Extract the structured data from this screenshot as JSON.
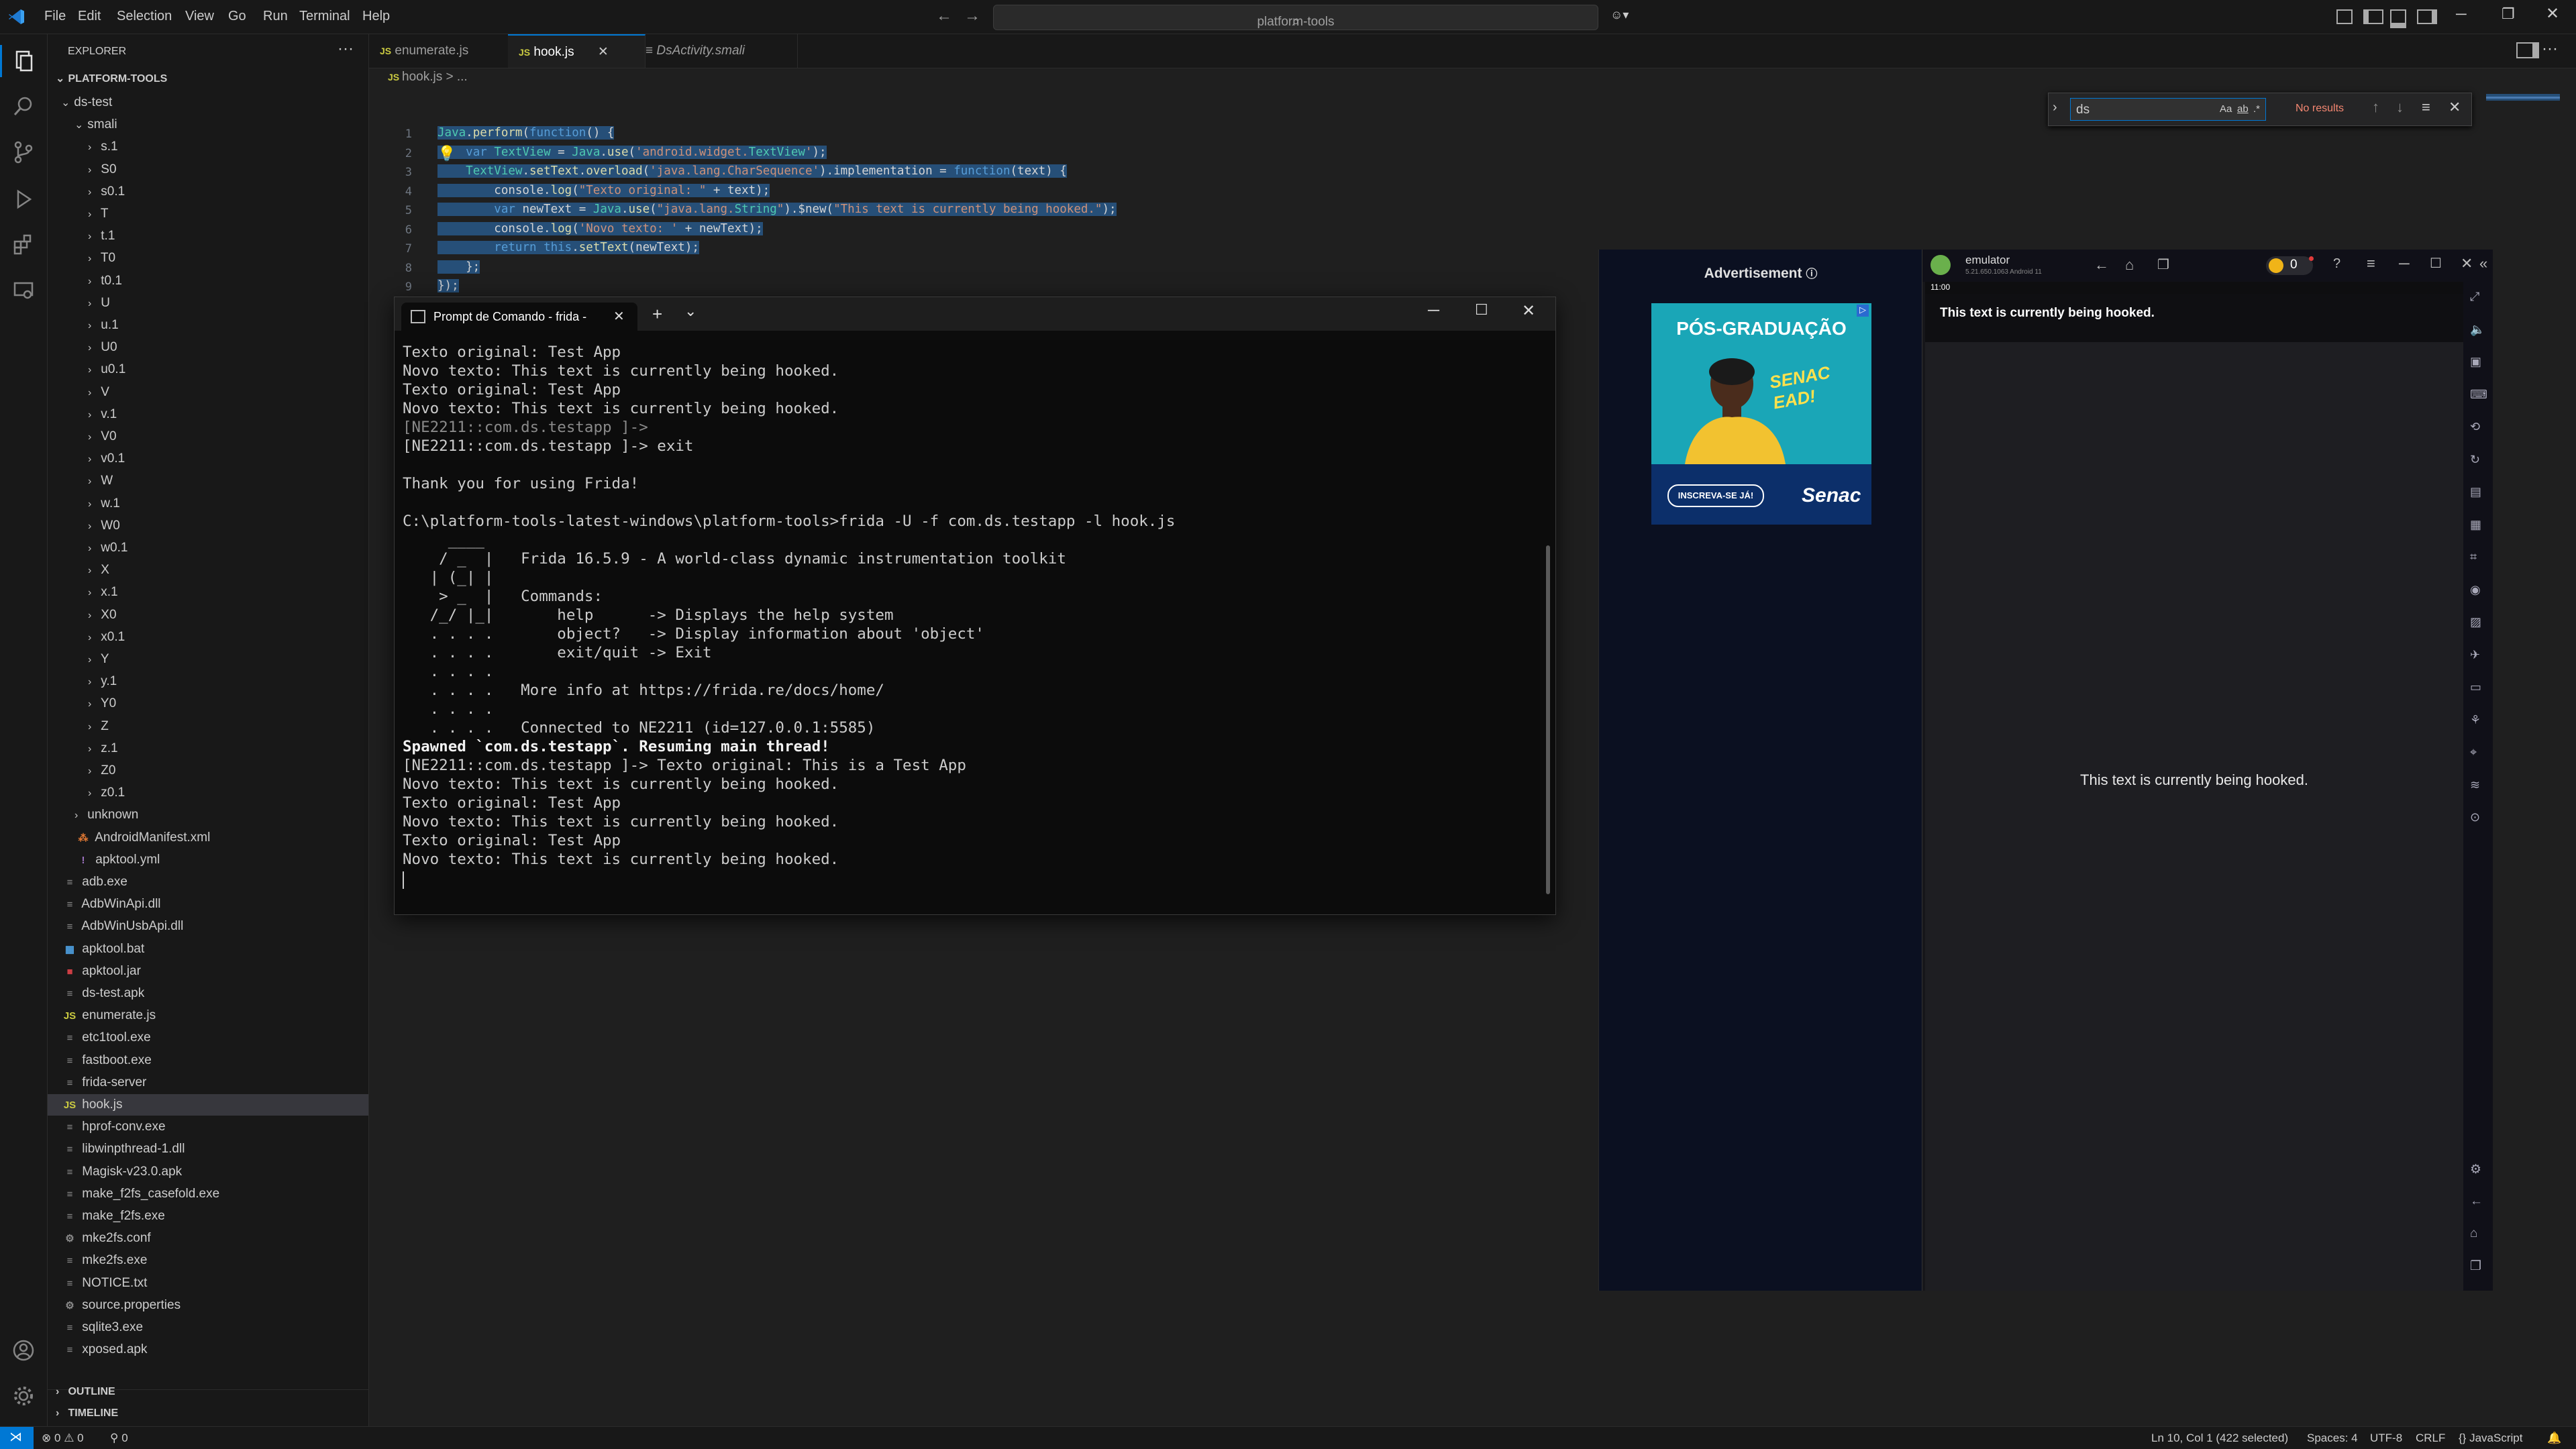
{
  "menu": [
    "File",
    "Edit",
    "Selection",
    "View",
    "Go",
    "Run",
    "Terminal",
    "Help"
  ],
  "command_center": "platform-tools",
  "sidebar": {
    "title": "EXPLORER",
    "root": "PLATFORM-TOOLS",
    "outline": "OUTLINE",
    "timeline": "TIMELINE",
    "tree": [
      {
        "label": "ds-test",
        "depth": 0,
        "chev": "v",
        "icon": ""
      },
      {
        "label": "smali",
        "depth": 1,
        "chev": "v",
        "icon": ""
      },
      {
        "label": "s.1",
        "depth": 2,
        "chev": ">",
        "icon": ""
      },
      {
        "label": "S0",
        "depth": 2,
        "chev": ">",
        "icon": ""
      },
      {
        "label": "s0.1",
        "depth": 2,
        "chev": ">",
        "icon": ""
      },
      {
        "label": "T",
        "depth": 2,
        "chev": ">",
        "icon": ""
      },
      {
        "label": "t.1",
        "depth": 2,
        "chev": ">",
        "icon": ""
      },
      {
        "label": "T0",
        "depth": 2,
        "chev": ">",
        "icon": ""
      },
      {
        "label": "t0.1",
        "depth": 2,
        "chev": ">",
        "icon": ""
      },
      {
        "label": "U",
        "depth": 2,
        "chev": ">",
        "icon": ""
      },
      {
        "label": "u.1",
        "depth": 2,
        "chev": ">",
        "icon": ""
      },
      {
        "label": "U0",
        "depth": 2,
        "chev": ">",
        "icon": ""
      },
      {
        "label": "u0.1",
        "depth": 2,
        "chev": ">",
        "icon": ""
      },
      {
        "label": "V",
        "depth": 2,
        "chev": ">",
        "icon": ""
      },
      {
        "label": "v.1",
        "depth": 2,
        "chev": ">",
        "icon": ""
      },
      {
        "label": "V0",
        "depth": 2,
        "chev": ">",
        "icon": ""
      },
      {
        "label": "v0.1",
        "depth": 2,
        "chev": ">",
        "icon": ""
      },
      {
        "label": "W",
        "depth": 2,
        "chev": ">",
        "icon": ""
      },
      {
        "label": "w.1",
        "depth": 2,
        "chev": ">",
        "icon": ""
      },
      {
        "label": "W0",
        "depth": 2,
        "chev": ">",
        "icon": ""
      },
      {
        "label": "w0.1",
        "depth": 2,
        "chev": ">",
        "icon": ""
      },
      {
        "label": "X",
        "depth": 2,
        "chev": ">",
        "icon": ""
      },
      {
        "label": "x.1",
        "depth": 2,
        "chev": ">",
        "icon": ""
      },
      {
        "label": "X0",
        "depth": 2,
        "chev": ">",
        "icon": ""
      },
      {
        "label": "x0.1",
        "depth": 2,
        "chev": ">",
        "icon": ""
      },
      {
        "label": "Y",
        "depth": 2,
        "chev": ">",
        "icon": ""
      },
      {
        "label": "y.1",
        "depth": 2,
        "chev": ">",
        "icon": ""
      },
      {
        "label": "Y0",
        "depth": 2,
        "chev": ">",
        "icon": ""
      },
      {
        "label": "Z",
        "depth": 2,
        "chev": ">",
        "icon": ""
      },
      {
        "label": "z.1",
        "depth": 2,
        "chev": ">",
        "icon": ""
      },
      {
        "label": "Z0",
        "depth": 2,
        "chev": ">",
        "icon": ""
      },
      {
        "label": "z0.1",
        "depth": 2,
        "chev": ">",
        "icon": ""
      },
      {
        "label": "unknown",
        "depth": 1,
        "chev": ">",
        "icon": ""
      },
      {
        "label": "AndroidManifest.xml",
        "depth": 1,
        "chev": "",
        "icon": "xml"
      },
      {
        "label": "apktool.yml",
        "depth": 1,
        "chev": "",
        "icon": "yml"
      },
      {
        "label": "adb.exe",
        "depth": 0,
        "chev": "",
        "icon": "file"
      },
      {
        "label": "AdbWinApi.dll",
        "depth": 0,
        "chev": "",
        "icon": "file"
      },
      {
        "label": "AdbWinUsbApi.dll",
        "depth": 0,
        "chev": "",
        "icon": "file"
      },
      {
        "label": "apktool.bat",
        "depth": 0,
        "chev": "",
        "icon": "bat"
      },
      {
        "label": "apktool.jar",
        "depth": 0,
        "chev": "",
        "icon": "jar"
      },
      {
        "label": "ds-test.apk",
        "depth": 0,
        "chev": "",
        "icon": "file"
      },
      {
        "label": "enumerate.js",
        "depth": 0,
        "chev": "",
        "icon": "js"
      },
      {
        "label": "etc1tool.exe",
        "depth": 0,
        "chev": "",
        "icon": "file"
      },
      {
        "label": "fastboot.exe",
        "depth": 0,
        "chev": "",
        "icon": "file"
      },
      {
        "label": "frida-server",
        "depth": 0,
        "chev": "",
        "icon": "file"
      },
      {
        "label": "hook.js",
        "depth": 0,
        "chev": "",
        "icon": "js",
        "selected": true
      },
      {
        "label": "hprof-conv.exe",
        "depth": 0,
        "chev": "",
        "icon": "file"
      },
      {
        "label": "libwinpthread-1.dll",
        "depth": 0,
        "chev": "",
        "icon": "file"
      },
      {
        "label": "Magisk-v23.0.apk",
        "depth": 0,
        "chev": "",
        "icon": "file"
      },
      {
        "label": "make_f2fs_casefold.exe",
        "depth": 0,
        "chev": "",
        "icon": "file"
      },
      {
        "label": "make_f2fs.exe",
        "depth": 0,
        "chev": "",
        "icon": "file"
      },
      {
        "label": "mke2fs.conf",
        "depth": 0,
        "chev": "",
        "icon": "gear"
      },
      {
        "label": "mke2fs.exe",
        "depth": 0,
        "chev": "",
        "icon": "file"
      },
      {
        "label": "NOTICE.txt",
        "depth": 0,
        "chev": "",
        "icon": "file"
      },
      {
        "label": "source.properties",
        "depth": 0,
        "chev": "",
        "icon": "gear"
      },
      {
        "label": "sqlite3.exe",
        "depth": 0,
        "chev": "",
        "icon": "file"
      },
      {
        "label": "xposed.apk",
        "depth": 0,
        "chev": "",
        "icon": "file"
      }
    ]
  },
  "tabs": [
    {
      "label": "enumerate.js",
      "icon": "JS",
      "italic": false
    },
    {
      "label": "hook.js",
      "icon": "JS",
      "italic": false,
      "active": true
    },
    {
      "label": "DsActivity.smali",
      "icon": "≡",
      "italic": true
    }
  ],
  "breadcrumb": {
    "file": "hook.js",
    "rest": "> ..."
  },
  "code_lines": [
    "Java.perform(function() {",
    "    var TextView = Java.use('android.widget.TextView');",
    "    TextView.setText.overload('java.lang.CharSequence').implementation = function(text) {",
    "        console.log(\"Texto original: \" + text);",
    "        var newText = Java.use(\"java.lang.String\").$new(\"This text is currently being hooked.\");",
    "        console.log('Novo texto: ' + newText);",
    "        return this.setText(newText);",
    "    };",
    "});"
  ],
  "line_numbers": [
    "1",
    "2",
    "3",
    "4",
    "5",
    "6",
    "7",
    "8",
    "9"
  ],
  "find": {
    "query": "ds",
    "result": "No results",
    "opt_case": "Aa",
    "opt_word": "ab",
    "opt_regex": ".*"
  },
  "terminal": {
    "tab_title": "Prompt de Comando - frida -",
    "lines": [
      {
        "t": "Texto original: Test App",
        "c": ""
      },
      {
        "t": "Novo texto: This text is currently being hooked.",
        "c": ""
      },
      {
        "t": "Texto original: Test App",
        "c": ""
      },
      {
        "t": "Novo texto: This text is currently being hooked.",
        "c": ""
      },
      {
        "t": "[NE2211::com.ds.testapp ]->",
        "c": "dim"
      },
      {
        "t": "[NE2211::com.ds.testapp ]-> exit",
        "c": ""
      },
      {
        "t": "",
        "c": ""
      },
      {
        "t": "Thank you for using Frida!",
        "c": ""
      },
      {
        "t": "",
        "c": ""
      },
      {
        "t": "C:\\platform-tools-latest-windows\\platform-tools>frida -U -f com.ds.testapp -l hook.js",
        "c": ""
      },
      {
        "t": "     ____",
        "c": ""
      },
      {
        "t": "    / _  |   Frida 16.5.9 - A world-class dynamic instrumentation toolkit",
        "c": ""
      },
      {
        "t": "   | (_| |",
        "c": ""
      },
      {
        "t": "    > _  |   Commands:",
        "c": ""
      },
      {
        "t": "   /_/ |_|       help      -> Displays the help system",
        "c": ""
      },
      {
        "t": "   . . . .       object?   -> Display information about 'object'",
        "c": ""
      },
      {
        "t": "   . . . .       exit/quit -> Exit",
        "c": ""
      },
      {
        "t": "   . . . .",
        "c": ""
      },
      {
        "t": "   . . . .   More info at https://frida.re/docs/home/",
        "c": ""
      },
      {
        "t": "   . . . .",
        "c": ""
      },
      {
        "t": "   . . . .   Connected to NE2211 (id=127.0.0.1:5585)",
        "c": ""
      },
      {
        "t": "Spawned `com.ds.testapp`. Resuming main thread!",
        "c": "bold"
      },
      {
        "t": "[NE2211::com.ds.testapp ]-> Texto original: This is a Test App",
        "c": ""
      },
      {
        "t": "Novo texto: This text is currently being hooked.",
        "c": ""
      },
      {
        "t": "Texto original: Test App",
        "c": ""
      },
      {
        "t": "Novo texto: This text is currently being hooked.",
        "c": ""
      },
      {
        "t": "Texto original: Test App",
        "c": ""
      },
      {
        "t": "Novo texto: This text is currently being hooked.",
        "c": ""
      }
    ]
  },
  "ad": {
    "header": "Advertisement",
    "headline": "PÓS-GRADUAÇÃO",
    "slogan": "SENAC EAD!",
    "cta": "INSCREVA-SE JÁ!",
    "brand": "Senac"
  },
  "emulator": {
    "title": "emulator",
    "subtitle": "5.21.650.1063  Android 11",
    "coins": "0",
    "clock": "11:00",
    "app_header_text": "This text is currently being hooked.",
    "center_text": "This text is currently being hooked."
  },
  "statusbar": {
    "errors": "0",
    "warnings": "0",
    "ports": "0",
    "position": "Ln 10, Col 1 (422 selected)",
    "spaces": "Spaces: 4",
    "encoding": "UTF-8",
    "eol": "CRLF",
    "language": "JavaScript"
  },
  "colors": {
    "accent": "#0078d4",
    "editor_bg": "#1f1f1f",
    "sidebar_bg": "#181818",
    "terminal_bg": "#0c0c0c",
    "ad_teal": "#1aa6b7",
    "find_no_results": "#f48771"
  }
}
